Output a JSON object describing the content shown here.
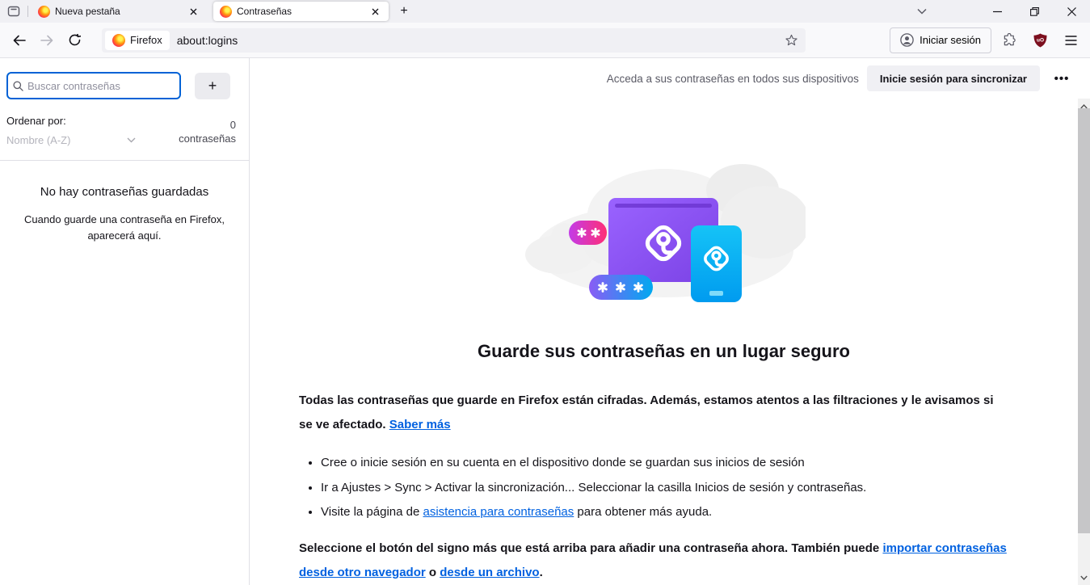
{
  "tabbar": {
    "tabs": [
      {
        "title": "Nueva pestaña",
        "active": false
      },
      {
        "title": "Contraseñas",
        "active": true
      }
    ],
    "new_tab_label": "+"
  },
  "toolbar": {
    "url_chip_label": "Firefox",
    "url_value": "about:logins",
    "signin_label": "Iniciar sesión"
  },
  "sidebar": {
    "search_placeholder": "Buscar contraseñas",
    "add_button_label": "+",
    "sort_label": "Ordenar por:",
    "sort_value": "Nombre (A-Z)",
    "count_number": "0",
    "count_label": "contraseñas",
    "empty_title": "No hay contraseñas guardadas",
    "empty_body_line1": "Cuando guarde una contraseña en Firefox,",
    "empty_body_line2": "aparecerá aquí."
  },
  "main": {
    "sync_hint": "Acceda a sus contraseñas en todos sus dispositivos",
    "sync_button_label": "Inicie sesión para sincronizar",
    "menu_label": "•••",
    "heading": "Guarde sus contraseñas en un lugar seguro",
    "intro": {
      "before": "Todas las contraseñas que guarde en Firefox están cifradas. Además, estamos atentos a las filtraciones y le avisamos si se ve afectado. ",
      "link": "Saber más"
    },
    "bullets": [
      {
        "text": "Cree o inicie sesión en su cuenta en el dispositivo donde se guardan sus inicios de sesión"
      },
      {
        "text": "Ir a Ajustes > Sync > Activar la sincronización... Seleccionar la casilla Inicios de sesión y contraseñas."
      },
      {
        "before": "Visite la página de ",
        "link": "asistencia para contraseñas",
        "after": " para obtener más ayuda."
      }
    ],
    "footer": {
      "before": "Seleccione el botón del signo más que está arriba para añadir una contraseña ahora. También puede ",
      "link1": "importar contraseñas desde otro navegador",
      "middle": " o ",
      "link2": "desde un archivo",
      "after": "."
    }
  },
  "colors": {
    "accent_blue": "#0062d6",
    "link_blue": "#0061e0",
    "illustration_purple": "#8a4fe9",
    "illustration_cyan": "#00b1f3",
    "illustration_pink": "#ff2e76",
    "ublock_red": "#7c0f1e"
  }
}
